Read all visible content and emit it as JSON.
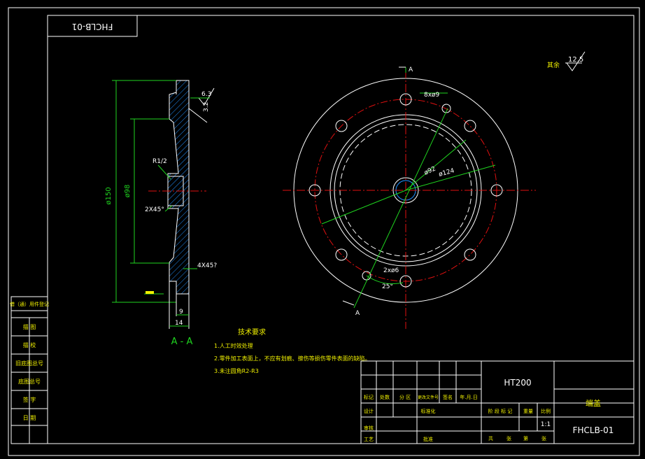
{
  "drawing_number": "FHCLB-01",
  "drawing_number_mirrored": "FHCLB-01",
  "roughness_other": {
    "label": "其余",
    "value": "12.5"
  },
  "section_view": {
    "title": "A - A",
    "dims": {
      "d150": "ø150",
      "d98": "ø98",
      "r": "R1/2",
      "chamfer1": "2X45°",
      "chamfer2": "4X45?",
      "w9": "9",
      "w14": "14",
      "ra1": "6.3",
      "ra2": "3.2"
    }
  },
  "front_view": {
    "section_mark": "A",
    "holes": "8xø9",
    "d92": "ø92",
    "d124": "ø124",
    "pins": "2xø6",
    "angle": "25°"
  },
  "tech_requirements": {
    "title": "技术要求",
    "items": [
      "1.人工时效处理",
      "2.零件加工表面上，不应有划痕、擦伤等损伤零件表面的缺陷。",
      "3.未注圆角R2-R3"
    ]
  },
  "side_table": [
    "借（通）用件登记",
    "描 图",
    "描 校",
    "旧底图总号",
    "底图总号",
    "签 字",
    "日 期"
  ],
  "title_block": {
    "material": "HT200",
    "part_name": "端盖",
    "code": "FHCLB-01",
    "scale": "1:1",
    "rev_headers": [
      "标记",
      "处数",
      "分 区",
      "更改文件号",
      "签名",
      "年.月.日"
    ],
    "roles": [
      "设计",
      "审核",
      "工艺"
    ],
    "std": "标准化",
    "approve": "批准",
    "stage_headers": [
      "阶 段 标 记",
      "重量",
      "比例"
    ],
    "sheet": [
      "共",
      "张",
      "第",
      "张"
    ]
  }
}
